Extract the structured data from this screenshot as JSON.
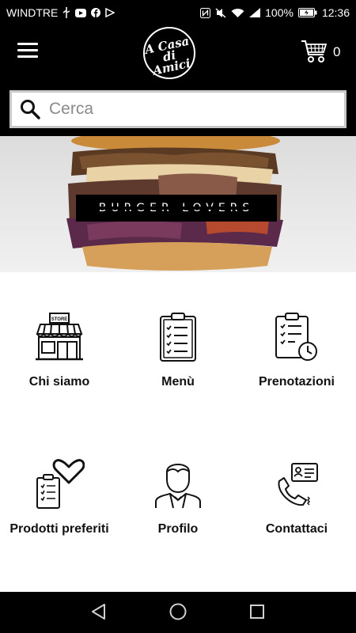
{
  "status_bar": {
    "carrier": "WINDTRE",
    "battery": "100%",
    "time": "12:36"
  },
  "header": {
    "menu_icon": "hamburger-menu-icon",
    "logo_text_line1": "A Casa",
    "logo_text_line2": "di Amici",
    "cart_icon": "shopping-cart-icon",
    "cart_count": "0"
  },
  "search": {
    "placeholder": "Cerca",
    "value": ""
  },
  "banner": {
    "label": "BURGER LOVERS"
  },
  "tiles": [
    {
      "label": "Chi siamo",
      "icon": "store-icon"
    },
    {
      "label": "Menù",
      "icon": "clipboard-list-icon"
    },
    {
      "label": "Prenotazioni",
      "icon": "clipboard-clock-icon"
    },
    {
      "label": "Prodotti preferiti",
      "icon": "favorite-list-icon"
    },
    {
      "label": "Profilo",
      "icon": "user-profile-icon"
    },
    {
      "label": "Contattaci",
      "icon": "contact-phone-icon"
    }
  ],
  "nav": {
    "back_icon": "back-triangle-icon",
    "home_icon": "home-circle-icon",
    "recents_icon": "recents-square-icon"
  },
  "colors": {
    "background_dark": "#000000",
    "content_bg": "#ffffff",
    "search_border": "#c8c8c8"
  }
}
